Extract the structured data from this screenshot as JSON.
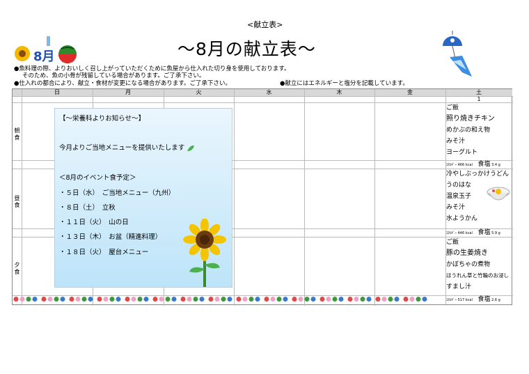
{
  "header": {
    "tag": "<献立表>",
    "title": "～8月の献立表～",
    "logo_text": "8月"
  },
  "notes": [
    "●魚料理の際、よりおいしく召し上がっていただくために魚屋から仕入れた切り身を使用しております。",
    "そのため、魚の小骨が残留している場合があります。ご了承下さい。",
    "●仕入れの都合により、献立・食材が変更になる場合があります。ご了承下さい。",
    "●献立にはエネルギーと塩分を記載しています。"
  ],
  "days": [
    "日",
    "月",
    "火",
    "水",
    "木",
    "金",
    "土"
  ],
  "saturday_date": "1",
  "meals": [
    {
      "label": "朝\n食",
      "items": [
        "ご飯",
        "照り焼きチキン",
        "めかぶの和え物",
        "みそ汁",
        "ヨーグルト"
      ],
      "energy_label": "ｴﾈﾙｷﾞｰ",
      "energy_value": "466",
      "energy_unit": "kcal",
      "salt_label": "食塩",
      "salt_value": "3.4",
      "salt_unit": "g"
    },
    {
      "label": "昼\n食",
      "items": [
        "冷やしぶっかけうどん",
        "うのはな",
        "温泉玉子",
        "みそ汁",
        "水ようかん"
      ],
      "energy_label": "ｴﾈﾙｷﾞｰ",
      "energy_value": "446",
      "energy_unit": "kcal",
      "salt_label": "食塩",
      "salt_value": "5.9",
      "salt_unit": "g"
    },
    {
      "label": "夕\n食",
      "items": [
        "ご飯",
        "豚の生姜焼き",
        "かぼちゃの煮物",
        "ほうれん草と竹輪のお浸し",
        "すまし汁"
      ],
      "energy_label": "ｴﾈﾙｷﾞｰ",
      "energy_value": "517",
      "energy_unit": "kcal",
      "salt_label": "食塩",
      "salt_value": "2.6",
      "salt_unit": "g"
    }
  ],
  "notice": {
    "heading": "【～栄養科よりお知らせ～】",
    "intro": "今月よりご当地メニューを提供いたします",
    "events_heading": "＜8月のイベント食予定＞",
    "events": [
      "・５日（水）　ご当地メニュー（九州）",
      "・８日（土）　立秋",
      "・１１日（火）　山の日",
      "・１３日（木）　お盆（精進料理）",
      "・１８日（火）　屋台メニュー"
    ]
  },
  "icons": [
    "sunflower-icon",
    "watermelon-icon",
    "wind-chime-icon",
    "udon-bowl-icon",
    "fish-cake-icon",
    "leaf-icon"
  ]
}
